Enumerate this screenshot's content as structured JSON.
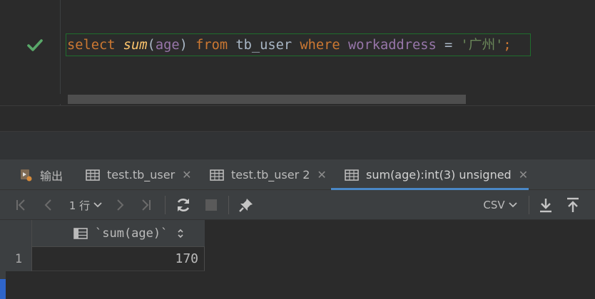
{
  "editor": {
    "status_icon": "check-icon",
    "sql": {
      "kw_select": "select",
      "fn_sum": "sum",
      "paren_open": "(",
      "col_age": "age",
      "paren_close": ")",
      "kw_from": "from",
      "table": "tb_user",
      "kw_where": "where",
      "col_workaddress": "workaddress",
      "op_eq": "=",
      "str_value": "'广州'",
      "semicolon": ";"
    }
  },
  "tabs": [
    {
      "label": "输出",
      "icon": "output-icon",
      "closable": false
    },
    {
      "label": "test.tb_user",
      "icon": "table-icon",
      "closable": true
    },
    {
      "label": "test.tb_user 2",
      "icon": "table-icon",
      "closable": true
    },
    {
      "label": "sum(age):int(3) unsigned",
      "icon": "table-icon",
      "closable": true,
      "active": true
    }
  ],
  "tab_close_glyph": "✕",
  "toolbar": {
    "rows_label": "1 行",
    "export_format": "CSV",
    "icons": [
      "first-page-icon",
      "previous-page-icon",
      "next-page-icon",
      "last-page-icon",
      "refresh-icon",
      "stop-icon",
      "pin-icon",
      "download-icon",
      "upload-icon"
    ]
  },
  "grid": {
    "columns": [
      "`sum(age)`"
    ],
    "rows": [
      {
        "num": "1",
        "values": [
          "170"
        ]
      }
    ]
  },
  "colors": {
    "accent": "#4a88c7",
    "keyword": "#cc7832",
    "function": "#ffc66d",
    "column": "#9876aa",
    "string": "#6a8759",
    "success": "#59a869"
  }
}
